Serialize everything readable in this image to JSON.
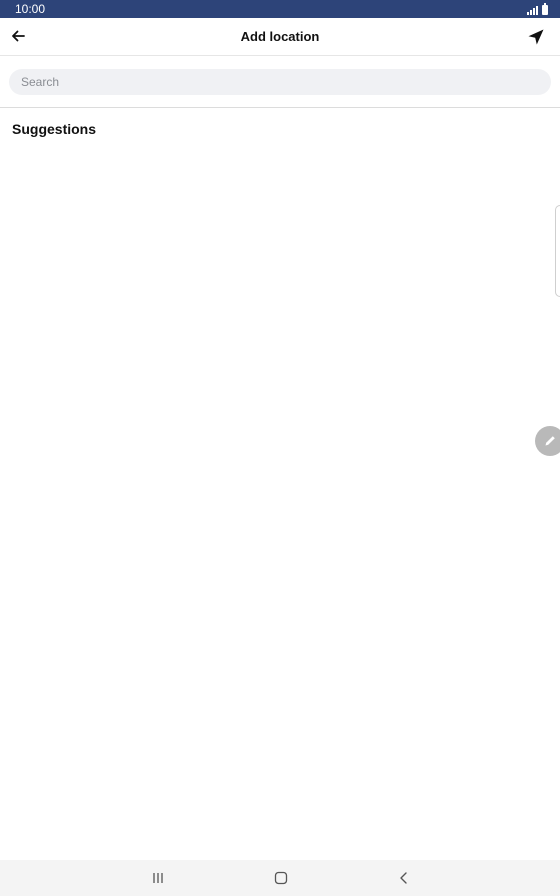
{
  "status_bar": {
    "time": "10:00",
    "icons": [
      "signal-icon",
      "battery-icon"
    ]
  },
  "app_bar": {
    "title": "Add location",
    "back_icon": "arrow-left-icon",
    "location_icon": "navigation-arrow-icon"
  },
  "search": {
    "placeholder": "Search",
    "value": ""
  },
  "suggestions": {
    "heading": "Suggestions",
    "items": []
  },
  "floating": {
    "side_handle": "side-panel-handle",
    "edit_icon": "pencil-icon"
  },
  "nav_bar": {
    "icons": [
      "recents-icon",
      "home-icon",
      "back-chevron-icon"
    ]
  },
  "colors": {
    "status_bar": "#2d4479",
    "search_bg": "#f0f1f4",
    "fab": "#b9b9b9",
    "nav_bar": "#f4f4f4"
  }
}
